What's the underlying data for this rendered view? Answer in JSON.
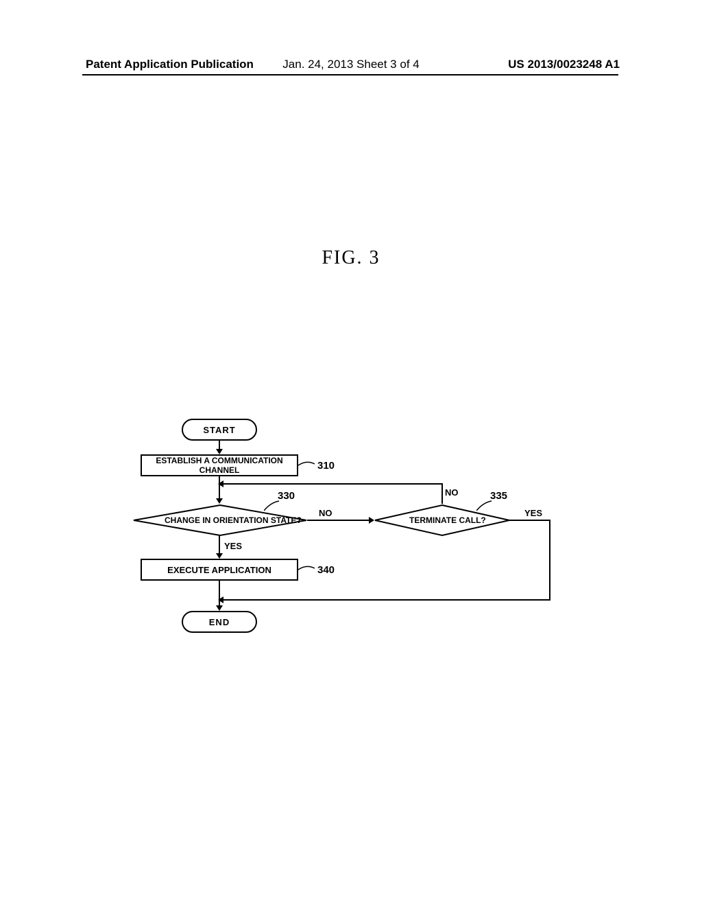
{
  "header": {
    "left": "Patent Application Publication",
    "center": "Jan. 24, 2013  Sheet 3 of 4",
    "right": "US 2013/0023248 A1"
  },
  "figure_label": "FIG. 3",
  "flowchart": {
    "start": "START",
    "end": "END",
    "step_310": "ESTABLISH A COMMUNICATION CHANNEL",
    "step_330": "CHANGE IN ORIENTATION STATE?",
    "step_335": "TERMINATE CALL?",
    "step_340": "EXECUTE APPLICATION",
    "ref_310": "310",
    "ref_330": "330",
    "ref_335": "335",
    "ref_340": "340",
    "label_yes": "YES",
    "label_no": "NO"
  }
}
